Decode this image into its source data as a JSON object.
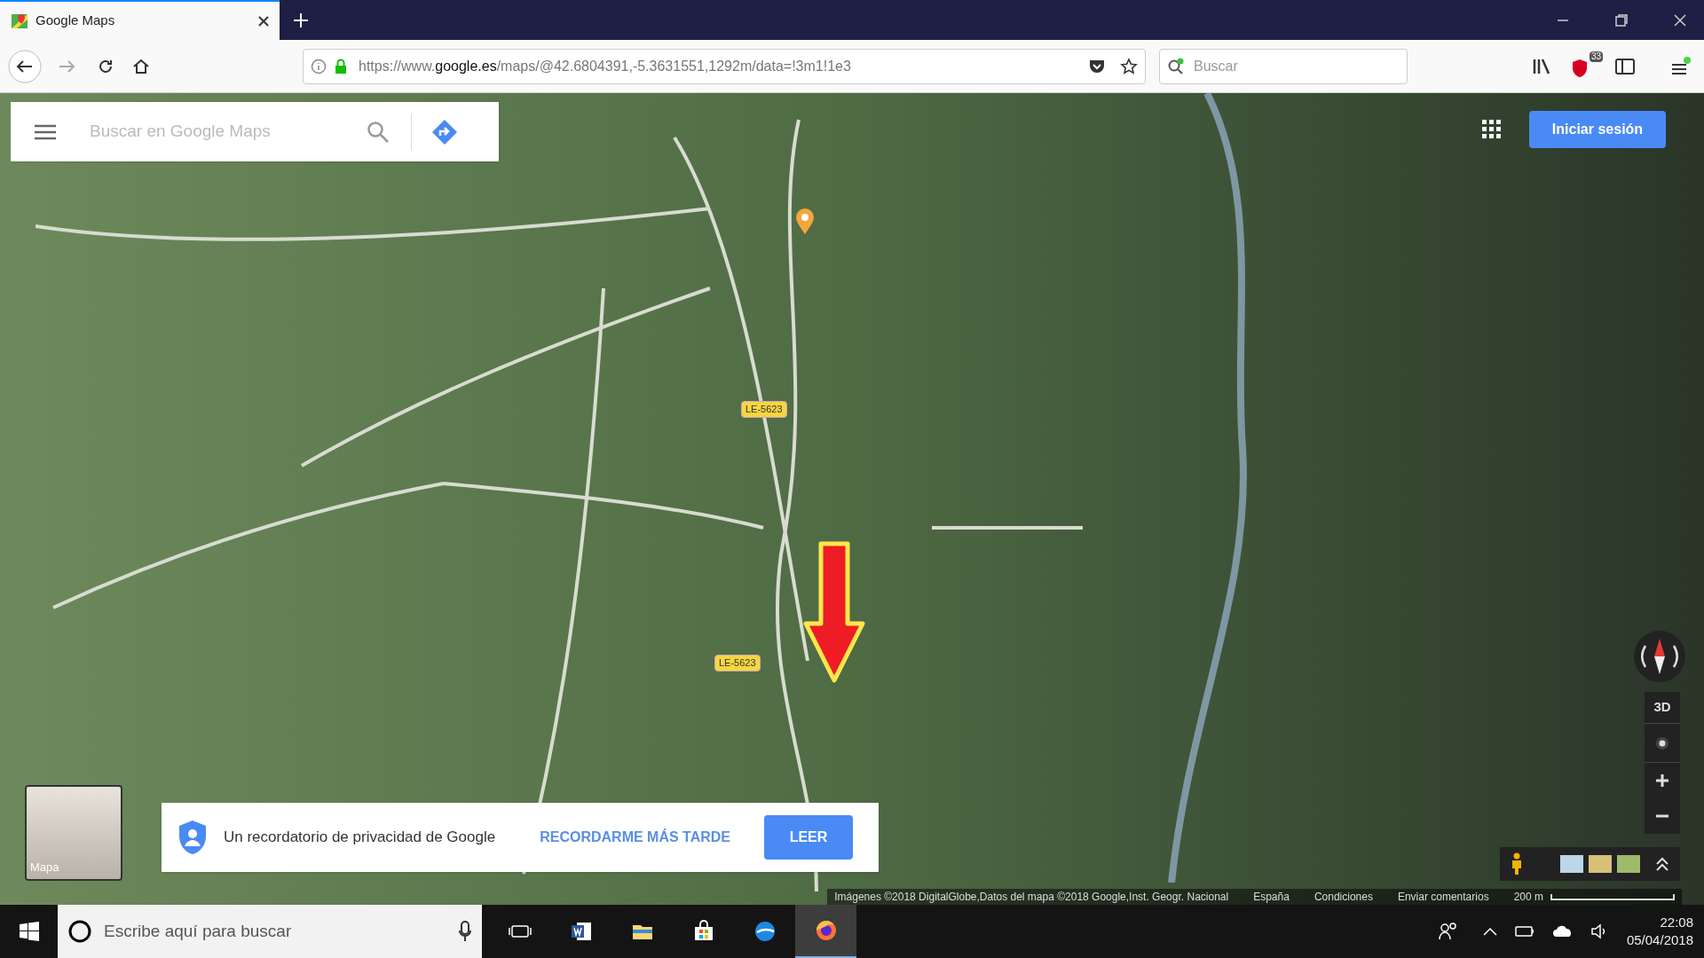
{
  "browser": {
    "tabs": [
      {
        "title": "Google Maps",
        "selected": true
      }
    ],
    "url": "https://www.**google.es**/maps/@42.6804391,-5.3631551,1292m/data=!3m1!1e3",
    "search": {
      "placeholder": "Buscar"
    },
    "extension_badge": "33"
  },
  "maps": {
    "search": {
      "placeholder": "Buscar en Google Maps"
    },
    "sign_in": "Iniciar sesión",
    "road_labels": [
      "LE-5623",
      "LE-5623"
    ],
    "tilt": "3D",
    "layer_label": "Mapa",
    "privacy": {
      "text": "Un recordatorio de privacidad de Google",
      "later": "RECORDARME MÁS TARDE",
      "read": "LEER"
    },
    "attribution": [
      "Imágenes ©2018 DigitalGlobe,Datos del mapa ©2018 Google,Inst. Geogr. Nacional",
      "España",
      "Condiciones",
      "Enviar comentarios"
    ],
    "scale": "200 m"
  },
  "taskbar": {
    "search": {
      "placeholder": "Escribe aquí para buscar"
    },
    "apps": [
      {
        "kind": "taskview",
        "active": false
      },
      {
        "kind": "word",
        "active": false
      },
      {
        "kind": "explorer",
        "active": false
      },
      {
        "kind": "store",
        "active": false
      },
      {
        "kind": "edge",
        "active": false
      },
      {
        "kind": "firefox",
        "active": true
      }
    ],
    "time": "22:08",
    "date": "05/04/2018"
  }
}
